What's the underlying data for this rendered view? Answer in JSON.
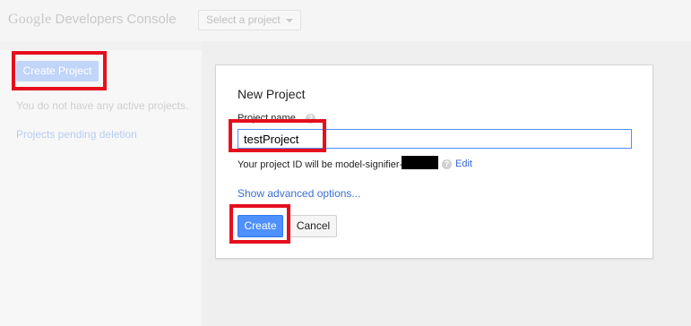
{
  "header": {
    "logo_google": "Google",
    "logo_product": "Developers Console",
    "project_select_label": "Select a project"
  },
  "sidebar": {
    "create_project_label": "Create Project",
    "no_projects_text": "You do not have any active projects.",
    "pending_link": "Projects pending deletion"
  },
  "dialog": {
    "title": "New Project",
    "field_label": "Project name",
    "name_value": "testProject",
    "project_id_text": "Your project ID will be model-signifier-",
    "edit_label": "Edit",
    "advanced_label": "Show advanced options...",
    "create_label": "Create",
    "cancel_label": "Cancel",
    "help_glyph": "?"
  },
  "colors": {
    "accent_blue": "#4d90fe",
    "link_blue": "#3b70d1",
    "highlight_red": "#e60f1d"
  }
}
